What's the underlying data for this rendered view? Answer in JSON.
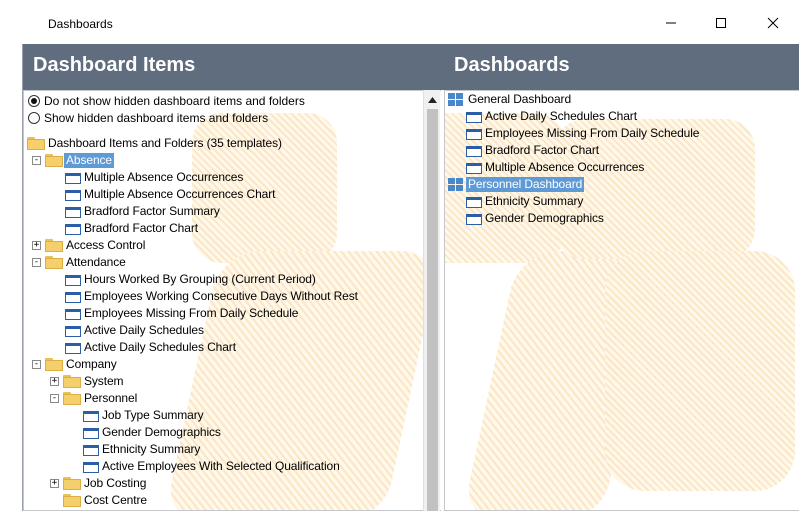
{
  "window": {
    "title": "Dashboards"
  },
  "header": {
    "left_title": "Dashboard Items",
    "right_title": "Dashboards"
  },
  "options": {
    "hide_label": "Do not show hidden dashboard items and folders",
    "show_label": "Show hidden dashboard items and folders",
    "selected": "hide"
  },
  "left_tree": [
    {
      "label": "Dashboard Items and Folders (35 templates)",
      "type": "folder",
      "level": 0,
      "expander": ""
    },
    {
      "label": "Absence",
      "type": "folder",
      "level": 1,
      "expander": "-",
      "selected": true
    },
    {
      "label": "Multiple Absence Occurrences",
      "type": "item",
      "level": 2
    },
    {
      "label": "Multiple Absence Occurrences Chart",
      "type": "item",
      "level": 2
    },
    {
      "label": "Bradford Factor Summary",
      "type": "item",
      "level": 2
    },
    {
      "label": "Bradford Factor Chart",
      "type": "item",
      "level": 2
    },
    {
      "label": "Access Control",
      "type": "folder",
      "level": 1,
      "expander": "+"
    },
    {
      "label": "Attendance",
      "type": "folder",
      "level": 1,
      "expander": "-"
    },
    {
      "label": "Hours Worked By Grouping (Current Period)",
      "type": "item",
      "level": 2
    },
    {
      "label": "Employees Working Consecutive Days Without Rest",
      "type": "item",
      "level": 2
    },
    {
      "label": "Employees Missing From Daily Schedule",
      "type": "item",
      "level": 2
    },
    {
      "label": "Active Daily Schedules",
      "type": "item",
      "level": 2
    },
    {
      "label": "Active Daily Schedules Chart",
      "type": "item",
      "level": 2
    },
    {
      "label": "Company",
      "type": "folder",
      "level": 1,
      "expander": "-"
    },
    {
      "label": "System",
      "type": "folder",
      "level": 2,
      "expander": "+"
    },
    {
      "label": "Personnel",
      "type": "folder",
      "level": 2,
      "expander": "-"
    },
    {
      "label": "Job Type Summary",
      "type": "item",
      "level": 3
    },
    {
      "label": "Gender Demographics",
      "type": "item",
      "level": 3
    },
    {
      "label": "Ethnicity Summary",
      "type": "item",
      "level": 3
    },
    {
      "label": "Active Employees With Selected Qualification",
      "type": "item",
      "level": 3
    },
    {
      "label": "Job Costing",
      "type": "folder",
      "level": 2,
      "expander": "+"
    },
    {
      "label": "Cost Centre",
      "type": "folder",
      "level": 2,
      "expander": ""
    }
  ],
  "right_tree": [
    {
      "label": "General Dashboard",
      "type": "dashboard",
      "level": 0
    },
    {
      "label": "Active Daily Schedules Chart",
      "type": "item",
      "level": 1
    },
    {
      "label": "Employees Missing From Daily Schedule",
      "type": "item",
      "level": 1
    },
    {
      "label": "Bradford Factor Chart",
      "type": "item",
      "level": 1
    },
    {
      "label": "Multiple Absence Occurrences",
      "type": "item",
      "level": 1
    },
    {
      "label": "Personnel Dashboard",
      "type": "dashboard",
      "level": 0,
      "selected": true
    },
    {
      "label": "Ethnicity Summary",
      "type": "item",
      "level": 1
    },
    {
      "label": "Gender Demographics",
      "type": "item",
      "level": 1
    }
  ],
  "colors": {
    "header_bg": "#5f6d7e",
    "selection": "#5e9ad6",
    "watermark": "#fbe6c4"
  }
}
